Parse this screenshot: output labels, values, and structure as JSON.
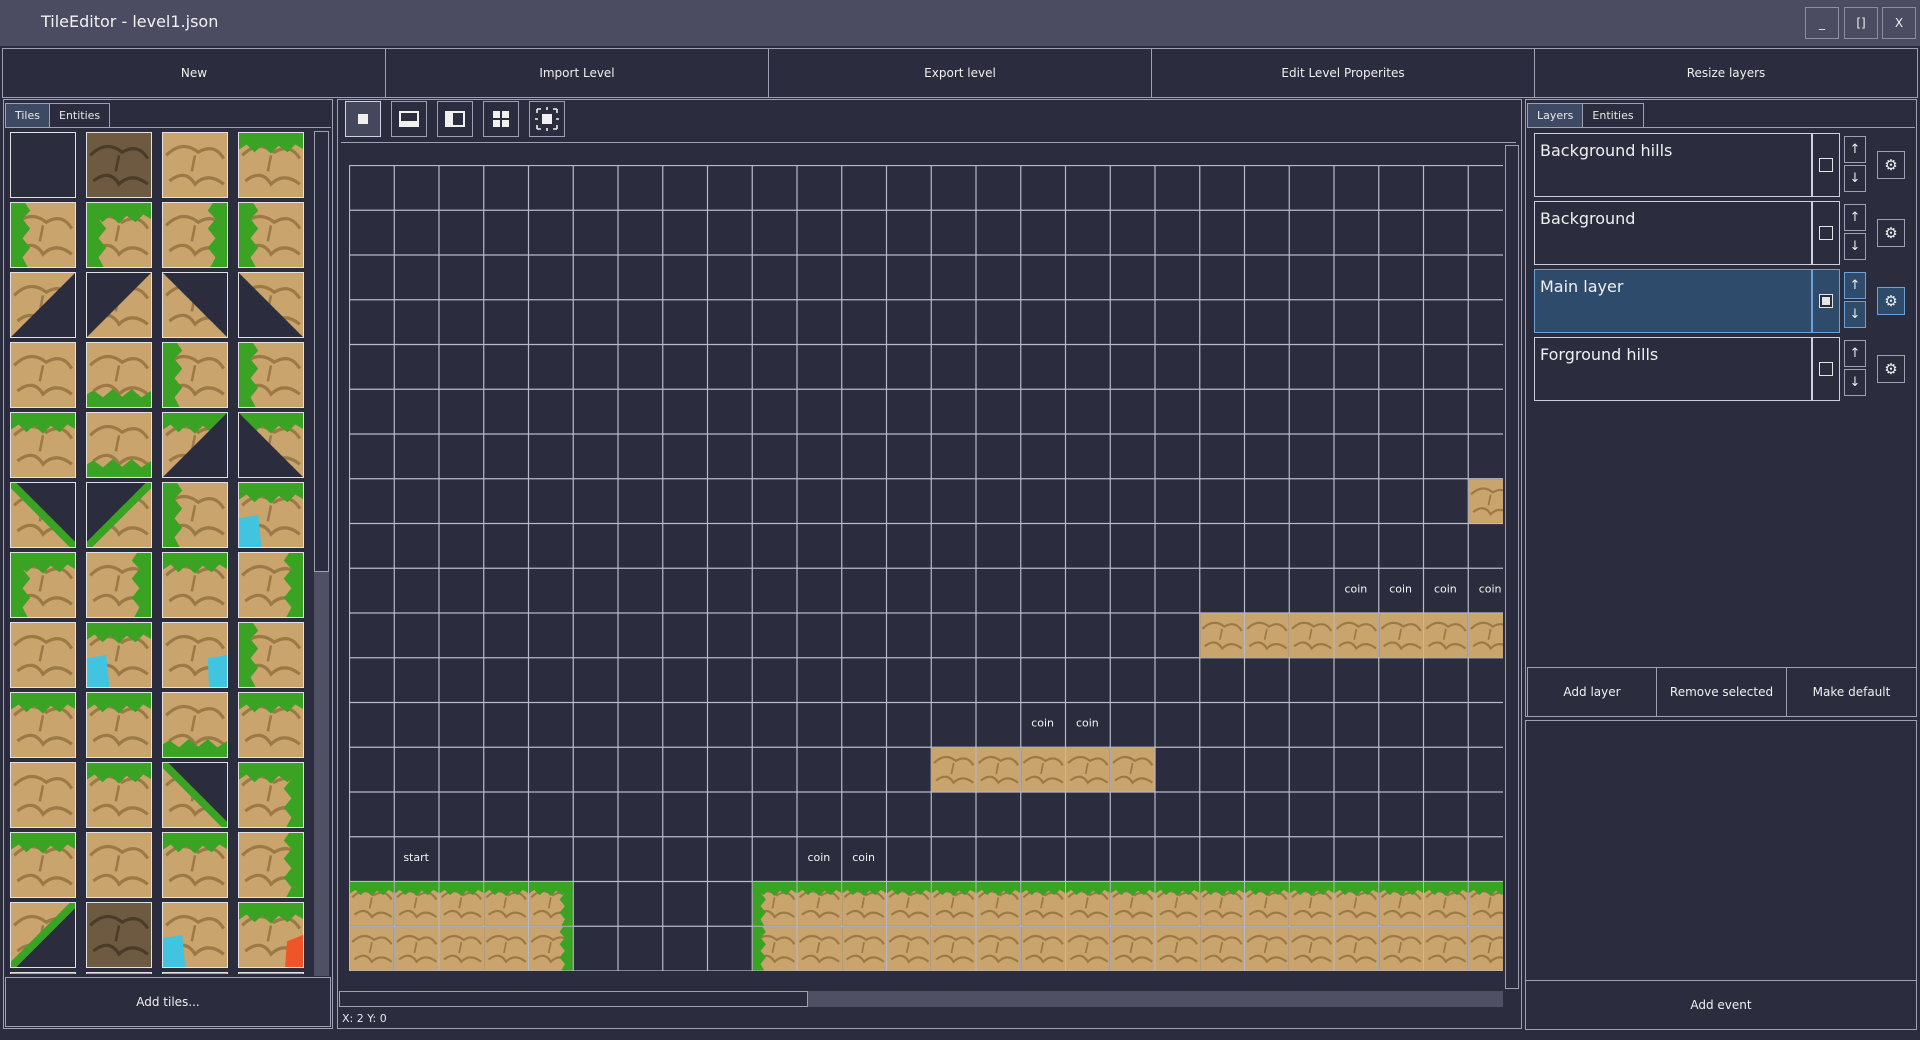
{
  "window": {
    "title": "TileEditor - level1.json",
    "minimize_label": "_",
    "maximize_label": "[]",
    "close_label": "X"
  },
  "menu": {
    "new": "New",
    "import": "Import Level",
    "export": "Export level",
    "edit_props": "Edit Level Properites",
    "resize": "Resize layers"
  },
  "left_panel": {
    "tabs": [
      "Tiles",
      "Entities"
    ],
    "active_tab": "Tiles",
    "add_tiles_label": "Add tiles..."
  },
  "toolbar": {
    "tools": [
      "single-tile-icon",
      "bottom-fill-icon",
      "left-fill-icon",
      "grid-fill-icon",
      "select-area-icon"
    ],
    "active_tool": "single-tile-icon"
  },
  "map": {
    "labels": {
      "start": "start",
      "coin": "coin"
    }
  },
  "status": {
    "coords": "X: 2 Y: 0"
  },
  "right_panel": {
    "tabs": [
      "Layers",
      "Entities"
    ],
    "active_tab": "Layers",
    "layers": [
      {
        "name": "Background hills",
        "visible": false,
        "selected": false
      },
      {
        "name": "Background",
        "visible": false,
        "selected": false
      },
      {
        "name": "Main layer",
        "visible": true,
        "selected": true
      },
      {
        "name": "Forground hills",
        "visible": false,
        "selected": false
      }
    ],
    "up_arrow": "↑",
    "down_arrow": "↓",
    "gear": "⚙",
    "add_layer": "Add layer",
    "remove_selected": "Remove selected",
    "make_default": "Make default",
    "add_event": "Add event"
  },
  "colors": {
    "background": "#2b2c3d",
    "titlebar": "#4b4c62",
    "grid_line": "#b9bac9",
    "rock": "#c9a46c",
    "grass": "#3aa324",
    "water": "#41c4e0",
    "lava": "#f0552a",
    "selected_layer": "#2f4b6b"
  }
}
